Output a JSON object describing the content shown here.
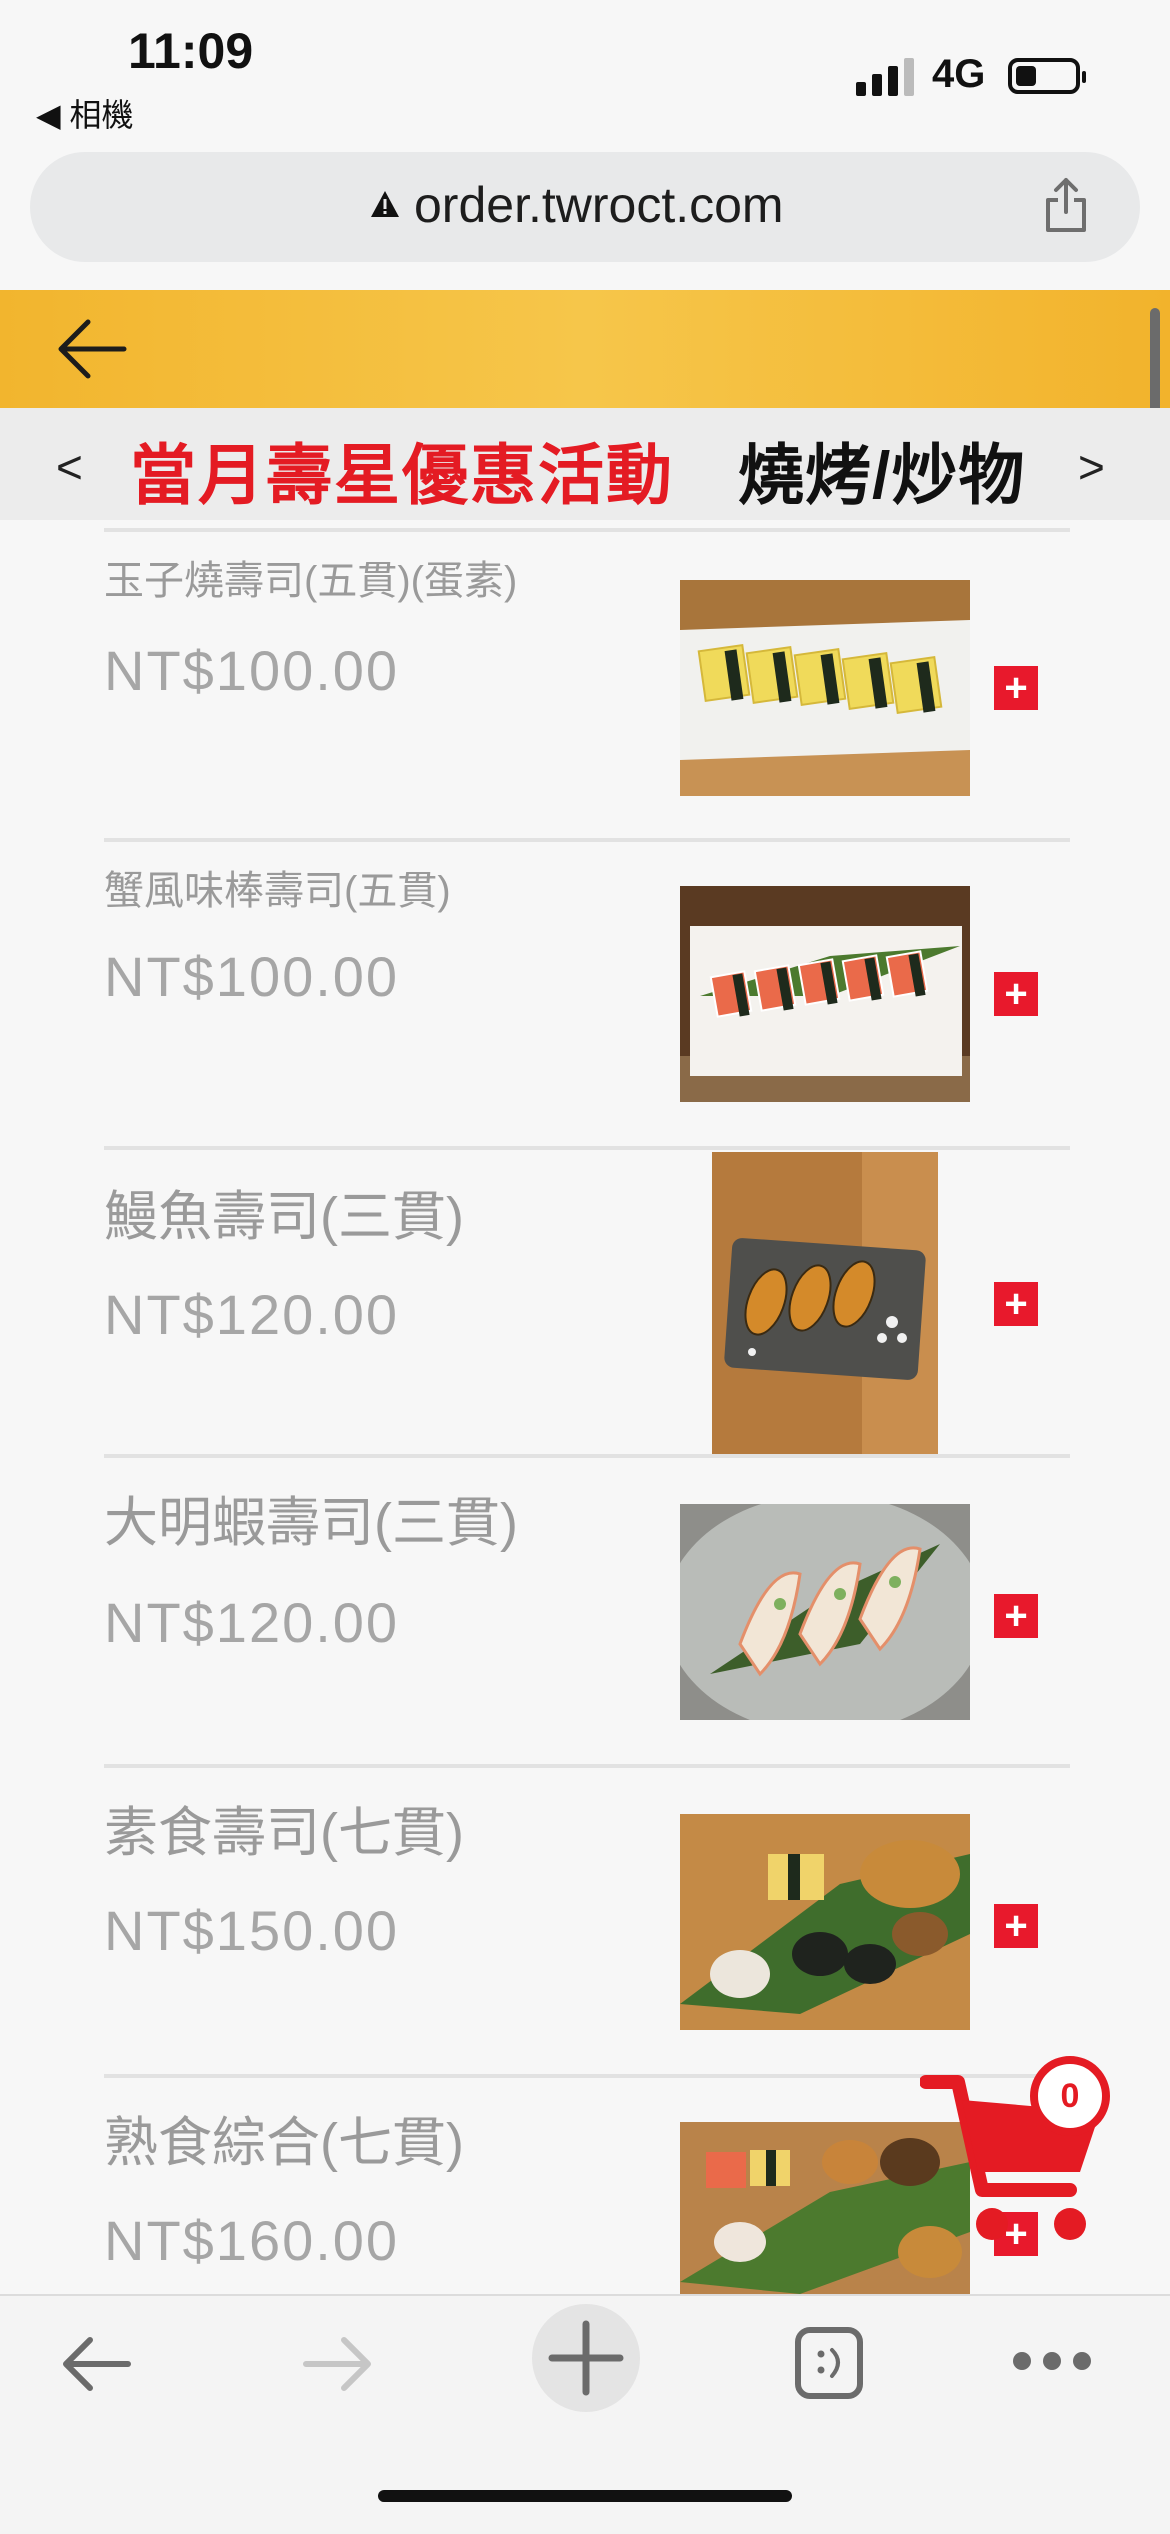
{
  "status_bar": {
    "time": "11:09",
    "back_app": "◀ 相機",
    "network": "4G"
  },
  "browser": {
    "url": "order.twroct.com"
  },
  "category_nav": {
    "prev": "<",
    "active": "當月壽星優惠活動",
    "next_name": "燒烤/炒物",
    "next": ">"
  },
  "items": [
    {
      "name": "玉子燒壽司(五貫)(蛋素)",
      "price": "NT$100.00",
      "add": "+"
    },
    {
      "name": "蟹風味棒壽司(五貫)",
      "price": "NT$100.00",
      "add": "+"
    },
    {
      "name": "鰻魚壽司(三貫)",
      "price": "NT$120.00",
      "add": "+"
    },
    {
      "name": "大明蝦壽司(三貫)",
      "price": "NT$120.00",
      "add": "+"
    },
    {
      "name": "素食壽司(七貫)",
      "price": "NT$150.00",
      "add": "+"
    },
    {
      "name": "熟食綜合(七貫)",
      "price": "NT$160.00",
      "add": "+"
    }
  ],
  "cart": {
    "count": "0"
  },
  "colors": {
    "header": "#f4bd3a",
    "accent": "#e41b23"
  },
  "icons": [
    "back-arrow-icon",
    "share-icon",
    "cart-icon",
    "toolbar-back-icon",
    "toolbar-forward-icon",
    "toolbar-plus-icon",
    "toolbar-tabs-icon",
    "toolbar-more-icon"
  ]
}
